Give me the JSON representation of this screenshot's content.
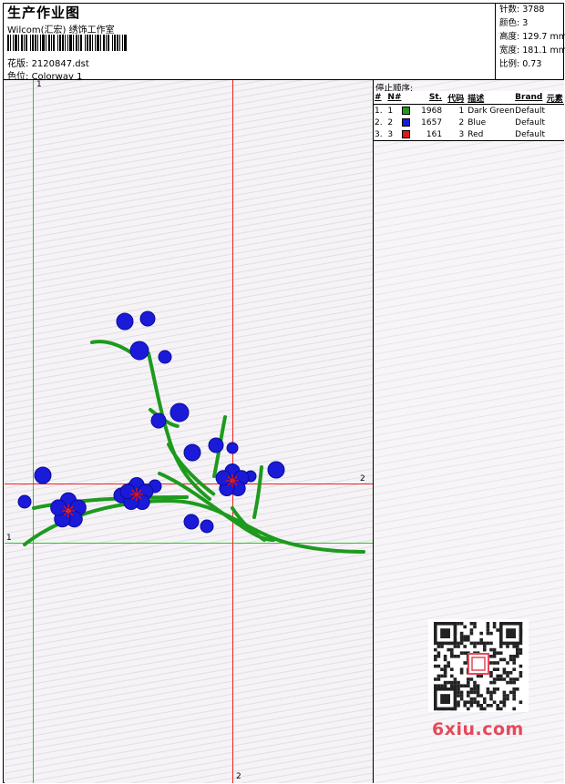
{
  "header": {
    "title": "生产作业图",
    "subtitle": "Wilcom(汇宏) 绣饰工作室",
    "design_file_label": "花版:",
    "design_file": "2120847.dst",
    "colorway_label": "色位:",
    "colorway": "Colorway 1"
  },
  "stats": [
    {
      "label": "针数:",
      "value": "3788"
    },
    {
      "label": "颜色:",
      "value": "3"
    },
    {
      "label": "高度:",
      "value": "129.7 mm"
    },
    {
      "label": "宽度:",
      "value": "181.1 mm"
    },
    {
      "label": "比例:",
      "value": "0.73"
    }
  ],
  "guides": {
    "green_1": "1",
    "green_1b": "1",
    "red_2": "2",
    "red_2b": "2"
  },
  "stops": {
    "title": "停止顺序:",
    "columns": {
      "idx": "#",
      "no": "N#",
      "stitches": "St.",
      "code": "代码",
      "desc": "描述",
      "brand": "Brand",
      "element": "元素"
    },
    "rows": [
      {
        "idx": "1.",
        "no": "1",
        "color": "#1e9a1e",
        "stitches": "1968",
        "code": "1",
        "desc": "Dark Green",
        "brand": "Default"
      },
      {
        "idx": "2.",
        "no": "2",
        "color": "#1a1ad8",
        "stitches": "1657",
        "code": "2",
        "desc": "Blue",
        "brand": "Default"
      },
      {
        "idx": "3.",
        "no": "3",
        "color": "#e01818",
        "stitches": "161",
        "code": "3",
        "desc": "Red",
        "brand": "Default"
      }
    ]
  },
  "watermark": {
    "text": "6xiu.com",
    "color": "#e4495a"
  },
  "colors": {
    "green": "#22cc22",
    "red": "#ee2222",
    "stem": "#1e9a1e",
    "petal": "#1a1ad8",
    "center": "#e01818"
  }
}
